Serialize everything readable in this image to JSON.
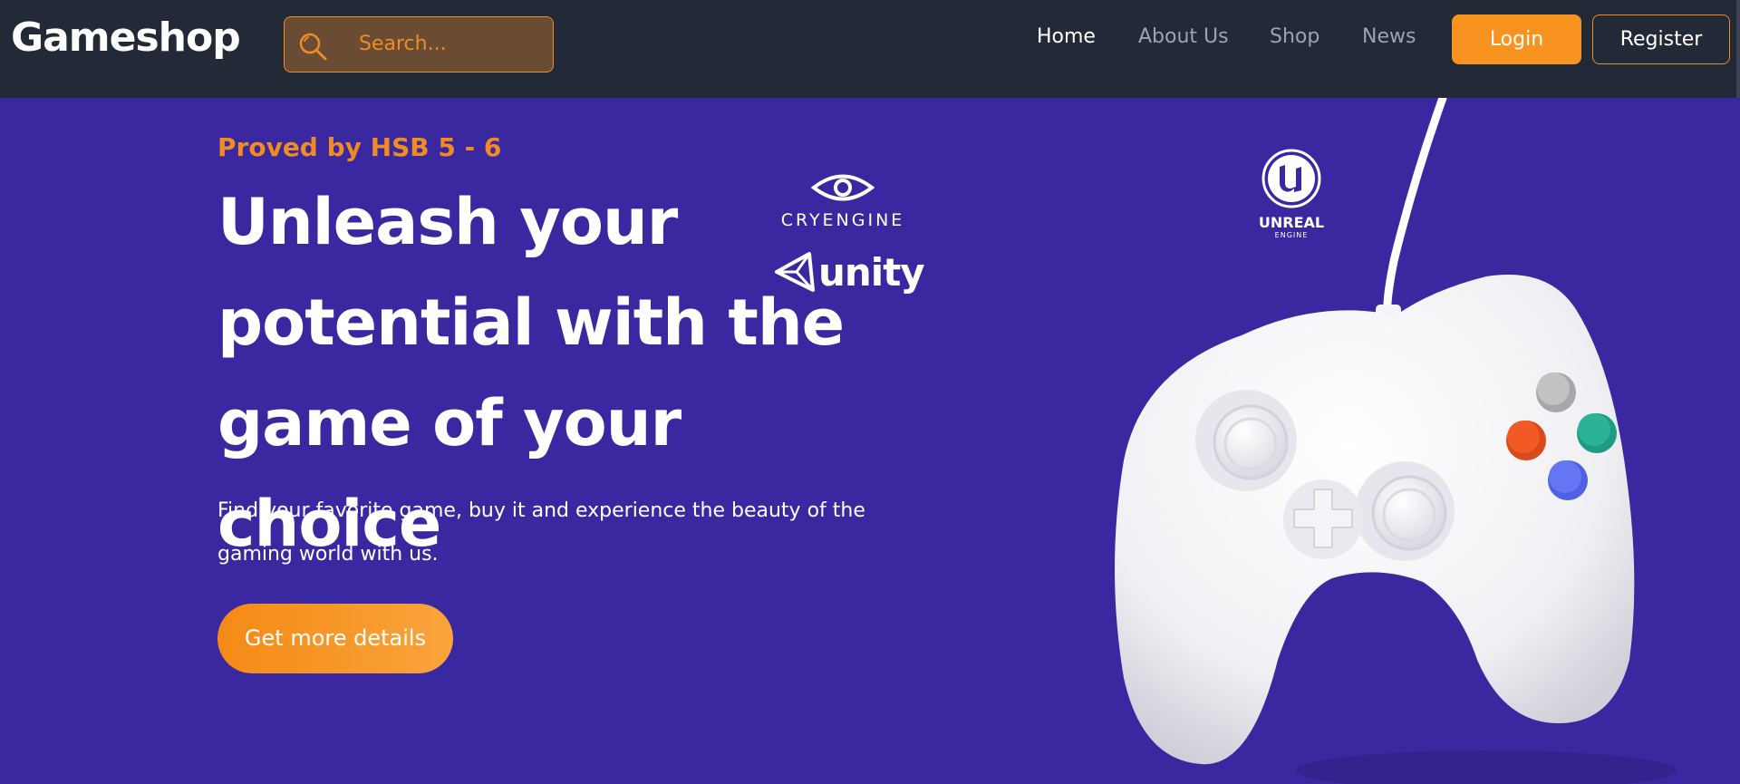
{
  "nav": {
    "logo": "Gameshop",
    "search_placeholder": "Search...",
    "links": [
      "Home",
      "About Us",
      "Shop",
      "News"
    ],
    "active_link": "Home",
    "login_label": "Login",
    "register_label": "Register"
  },
  "hero": {
    "tagline": "Proved by HSB 5 - 6",
    "headline": "Unleash your potential with the game of your choice",
    "subtext": "Find your favorite game, buy it and experience the beauty of the gaming world with us.",
    "cta_label": "Get more details"
  },
  "engine_logos": {
    "cryengine": "CRYENGINE",
    "unity": "unity",
    "unreal_1": "UNREAL",
    "unreal_2": "ENGINE"
  },
  "icons": {
    "search": "search-icon",
    "controller": "gamepad-image"
  },
  "colors": {
    "nav_bg": "#222a38",
    "hero_bg": "#3a28a0",
    "accent": "#f7931e"
  }
}
